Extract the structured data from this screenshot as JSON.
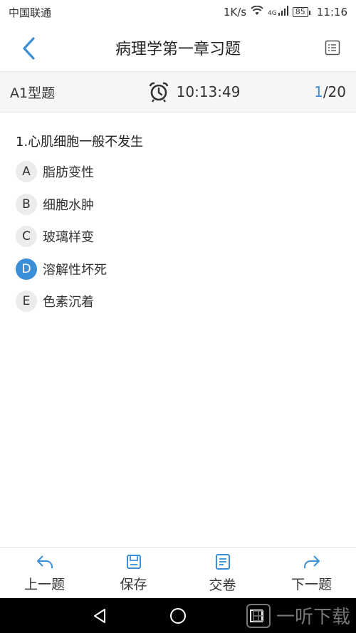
{
  "status_bar": {
    "carrier": "中国联通",
    "speed": "1K/s",
    "network": "4G",
    "battery": "85",
    "time": "11:16"
  },
  "header": {
    "title": "病理学第一章习题"
  },
  "info_bar": {
    "question_type": "A1型题",
    "timer": "10:13:49",
    "current": "1",
    "total": "/20"
  },
  "question": {
    "text": "1.心肌细胞一般不发生",
    "options": [
      {
        "letter": "A",
        "text": "脂肪变性",
        "selected": false
      },
      {
        "letter": "B",
        "text": "细胞水肿",
        "selected": false
      },
      {
        "letter": "C",
        "text": "玻璃样变",
        "selected": false
      },
      {
        "letter": "D",
        "text": "溶解性坏死",
        "selected": true
      },
      {
        "letter": "E",
        "text": "色素沉着",
        "selected": false
      }
    ]
  },
  "toolbar": {
    "prev": "上一题",
    "save": "保存",
    "submit": "交卷",
    "next": "下一题"
  },
  "watermark": {
    "text": "一听下载"
  },
  "colors": {
    "accent": "#3a8fd8",
    "option_bg": "#ececec"
  }
}
